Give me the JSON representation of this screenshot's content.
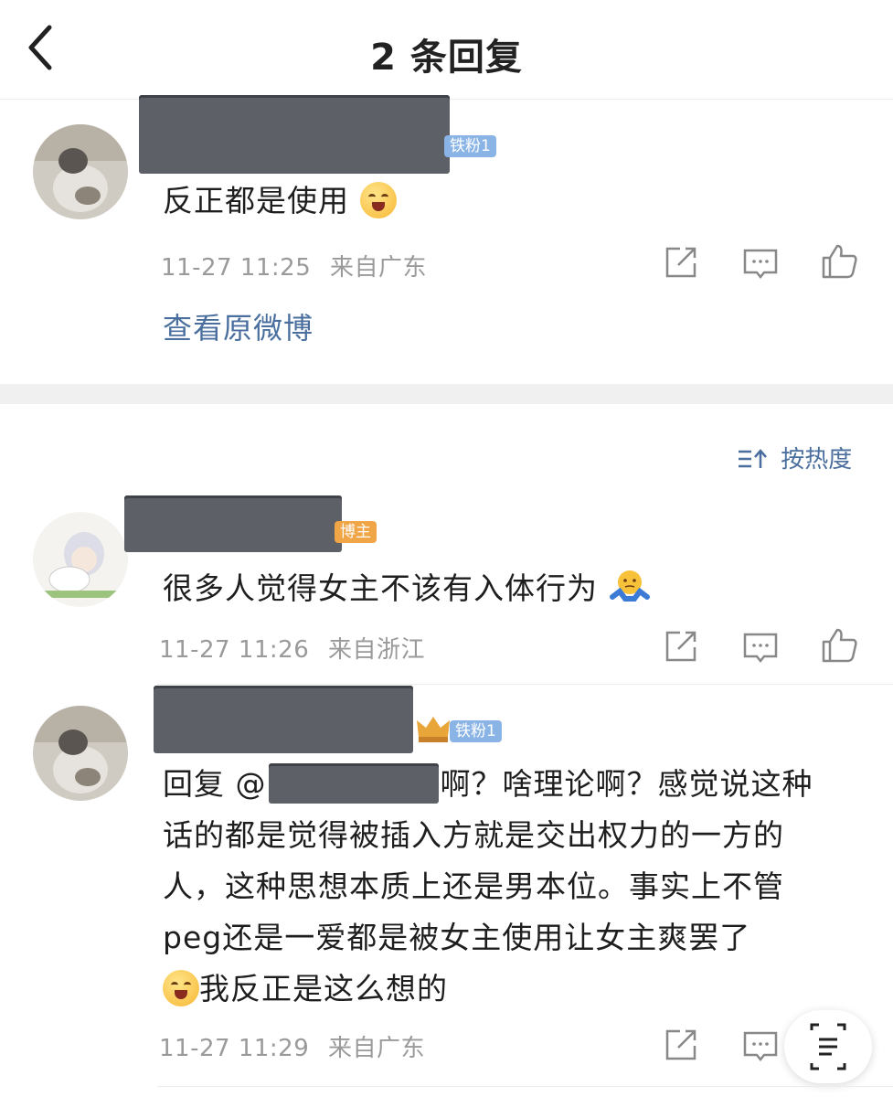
{
  "header": {
    "title": "2 条回复"
  },
  "root_comment": {
    "badge": "铁粉1",
    "text": "反正都是使用",
    "time": "11-27 11:25",
    "location": "来自广东",
    "view_original": "查看原微博"
  },
  "sort": {
    "label": "按热度"
  },
  "replies": [
    {
      "badge": "博主",
      "text": "很多人觉得女主不该有入体行为",
      "time": "11-27 11:26",
      "location": "来自浙江"
    },
    {
      "badge": "铁粉1",
      "reply_prefix": "回复 @",
      "line1": "啊？啥理论啊？感觉说这种",
      "line2": "话的都是觉得被插入方就是交出权力的一方的",
      "line3": "人，这种思想本质上还是男本位。事实上不管",
      "line4": "peg还是一爱都是被女主使用让女主爽罢了",
      "line5": "我反正是这么想的",
      "time": "11-27 11:29",
      "location": "来自广东"
    }
  ],
  "colors": {
    "link": "#4a6f9e",
    "meta": "#9a9a9a",
    "badge_blue": "#8ab4e6",
    "badge_orange": "#f0a546",
    "redaction": "#5d6066"
  }
}
